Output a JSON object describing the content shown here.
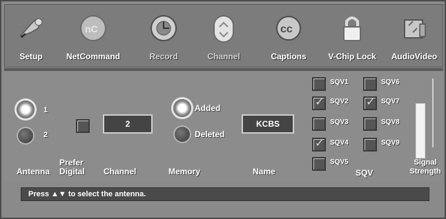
{
  "menu": [
    {
      "label": "Setup",
      "icon": "setup-icon"
    },
    {
      "label": "NetCommand",
      "icon": "netcommand-icon"
    },
    {
      "label": "Record",
      "icon": "record-icon"
    },
    {
      "label": "Channel",
      "icon": "channel-icon"
    },
    {
      "label": "Captions",
      "icon": "captions-icon"
    },
    {
      "label": "V-Chip Lock",
      "icon": "lock-icon"
    },
    {
      "label": "AudioVideo",
      "icon": "audiovideo-icon"
    }
  ],
  "antenna": {
    "label": "Antenna",
    "options": [
      "1",
      "2"
    ],
    "selected": "1"
  },
  "prefer_digital": {
    "label": "Prefer Digital"
  },
  "channel": {
    "label": "Channel",
    "value": "2"
  },
  "memory": {
    "label": "Memory",
    "options": [
      "Added",
      "Deleted"
    ],
    "selected": "Added"
  },
  "name": {
    "label": "Name",
    "value": "KCBS"
  },
  "sqv": {
    "label": "SQV",
    "items": [
      {
        "label": "SQV1",
        "checked": false
      },
      {
        "label": "SQV2",
        "checked": true
      },
      {
        "label": "SQV3",
        "checked": false
      },
      {
        "label": "SQV4",
        "checked": true
      },
      {
        "label": "SQV5",
        "checked": false
      },
      {
        "label": "SQV6",
        "checked": false
      },
      {
        "label": "SQV7",
        "checked": true
      },
      {
        "label": "SQV8",
        "checked": false
      },
      {
        "label": "SQV9",
        "checked": false
      }
    ]
  },
  "signal": {
    "label": "Signal Strength"
  },
  "status": {
    "text": "Press ▲▼ to select the antenna."
  }
}
